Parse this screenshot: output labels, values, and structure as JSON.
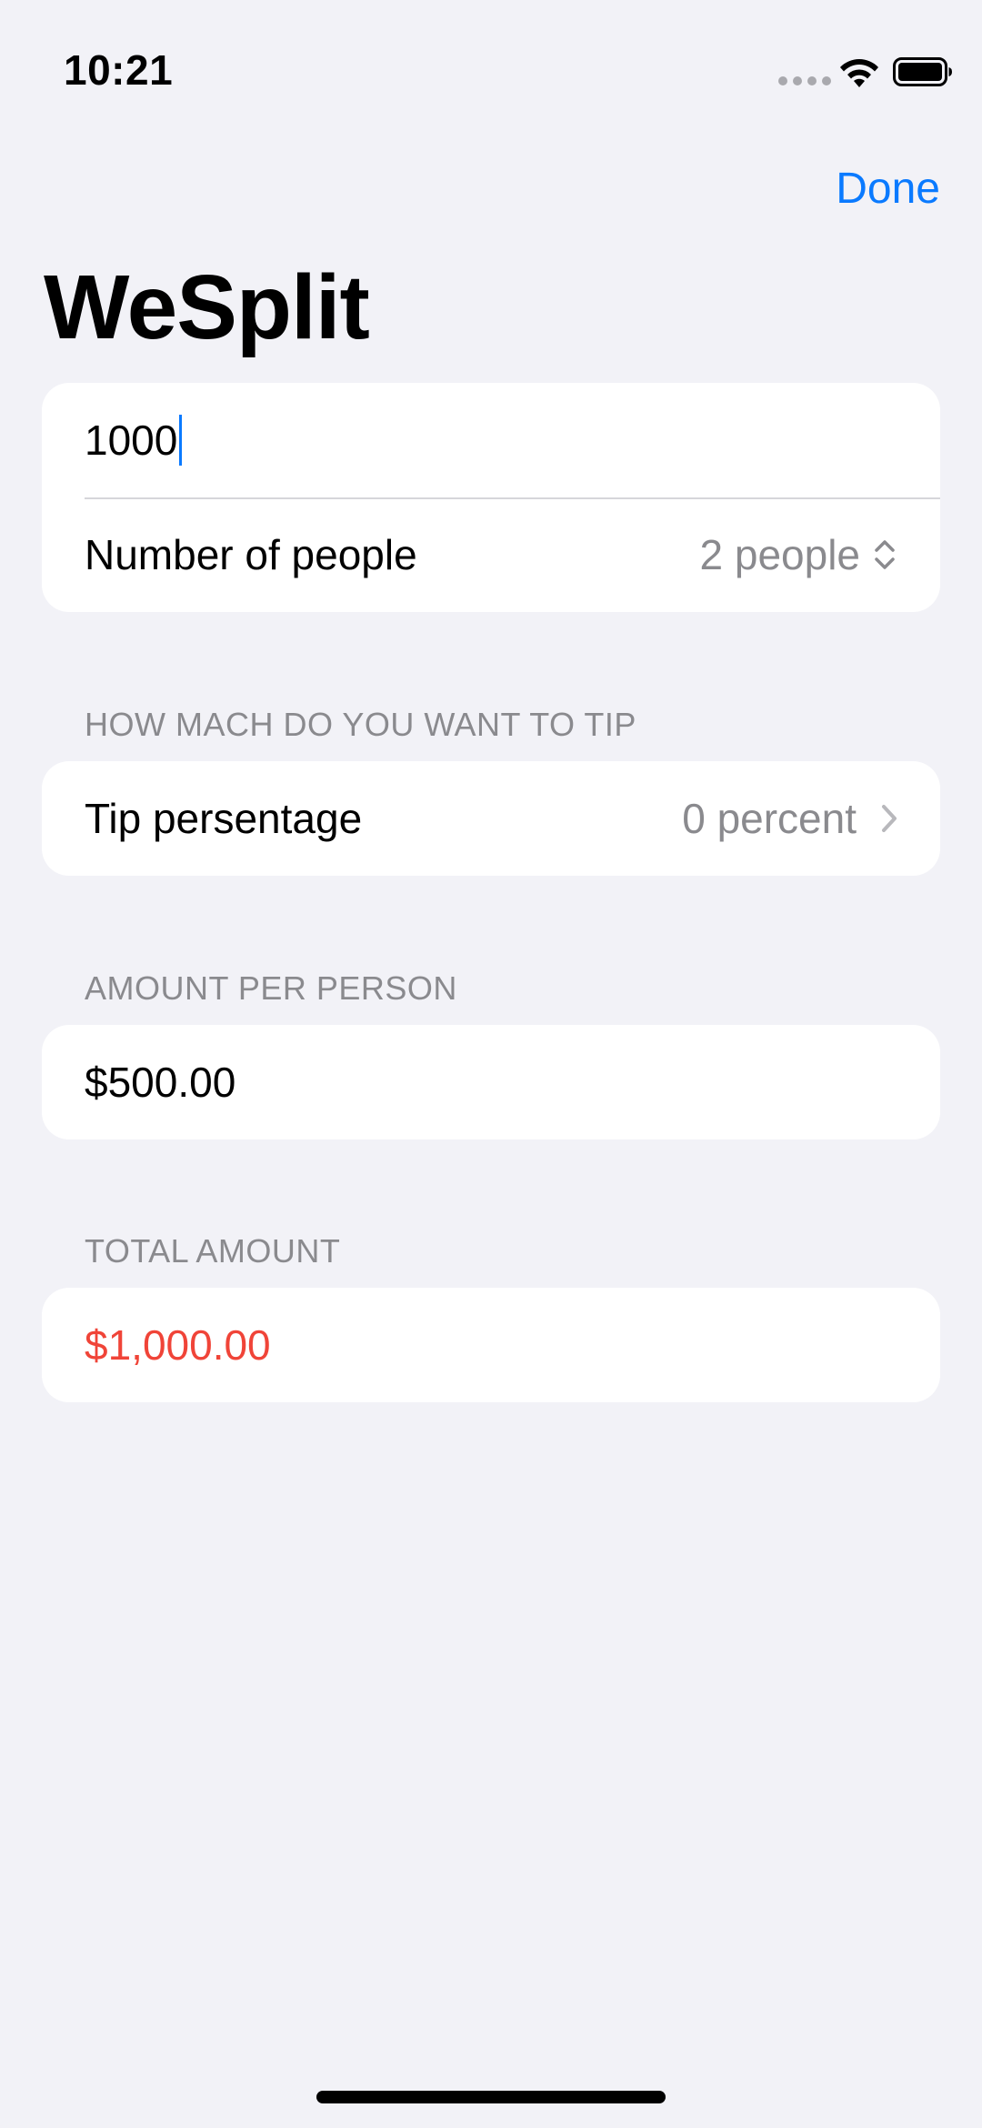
{
  "status_bar": {
    "time": "10:21"
  },
  "nav": {
    "done_label": "Done",
    "title": "WeSplit"
  },
  "amount_section": {
    "amount_value": "1000",
    "people_label": "Number of people",
    "people_value": "2 people"
  },
  "tip_section": {
    "header": "HOW MACH DO YOU WANT TO TIP",
    "tip_label": "Tip persentage",
    "tip_value": "0 percent"
  },
  "per_person_section": {
    "header": "AMOUNT PER PERSON",
    "value": "$500.00"
  },
  "total_section": {
    "header": "TOTAL AMOUNT",
    "value": "$1,000.00"
  },
  "colors": {
    "background": "#F2F2F7",
    "accent": "#0A7AFF",
    "total_red": "#F04438",
    "secondary_text": "#8A8A8E"
  },
  "icons": [
    "signal-icon",
    "wifi-icon",
    "battery-icon",
    "updown-chevron-icon",
    "chevron-right-icon"
  ]
}
